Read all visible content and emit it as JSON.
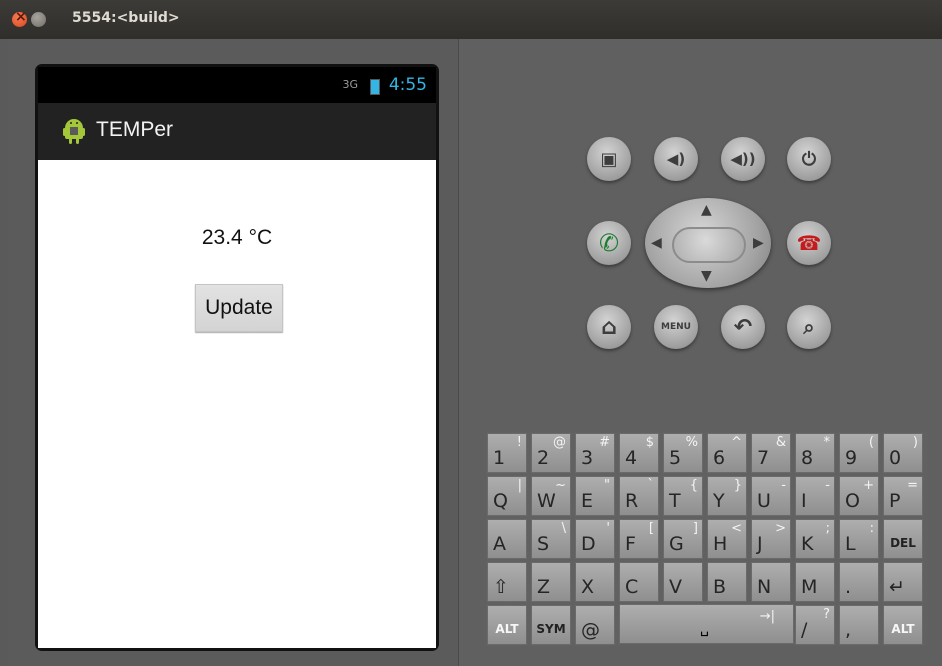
{
  "window": {
    "title": "5554:<build>"
  },
  "device": {
    "statusbar": {
      "signal": "3G",
      "time": "4:55"
    },
    "app": {
      "title": "TEMPer",
      "temperature": "23.4 °C",
      "update_label": "Update"
    }
  },
  "controls": {
    "menu_label": "MENU",
    "icons": [
      "camera-icon",
      "volume-down-icon",
      "volume-up-icon",
      "power-icon",
      "call-icon",
      "end-call-icon",
      "home-icon",
      "menu-icon",
      "back-icon",
      "search-icon"
    ]
  },
  "keyboard": {
    "rows": [
      [
        {
          "main": "1",
          "alt": "!"
        },
        {
          "main": "2",
          "alt": "@"
        },
        {
          "main": "3",
          "alt": "#"
        },
        {
          "main": "4",
          "alt": "$"
        },
        {
          "main": "5",
          "alt": "%"
        },
        {
          "main": "6",
          "alt": "^"
        },
        {
          "main": "7",
          "alt": "&"
        },
        {
          "main": "8",
          "alt": "*"
        },
        {
          "main": "9",
          "alt": "("
        },
        {
          "main": "0",
          "alt": ")"
        }
      ],
      [
        {
          "main": "Q",
          "alt": "|"
        },
        {
          "main": "W",
          "alt": "~"
        },
        {
          "main": "E",
          "alt": "\""
        },
        {
          "main": "R",
          "alt": "`"
        },
        {
          "main": "T",
          "alt": "{"
        },
        {
          "main": "Y",
          "alt": "}"
        },
        {
          "main": "U",
          "alt": "-"
        },
        {
          "main": "I",
          "alt": "-"
        },
        {
          "main": "O",
          "alt": "+"
        },
        {
          "main": "P",
          "alt": "="
        }
      ],
      [
        {
          "main": "A",
          "alt": ""
        },
        {
          "main": "S",
          "alt": "\\"
        },
        {
          "main": "D",
          "alt": "'"
        },
        {
          "main": "F",
          "alt": "["
        },
        {
          "main": "G",
          "alt": "]"
        },
        {
          "main": "H",
          "alt": "<"
        },
        {
          "main": "J",
          "alt": ">"
        },
        {
          "main": "K",
          "alt": ";"
        },
        {
          "main": "L",
          "alt": ":"
        },
        {
          "main": "DEL",
          "alt": ""
        }
      ],
      [
        {
          "main": "⇧",
          "alt": ""
        },
        {
          "main": "Z",
          "alt": ""
        },
        {
          "main": "X",
          "alt": ""
        },
        {
          "main": "C",
          "alt": ""
        },
        {
          "main": "V",
          "alt": ""
        },
        {
          "main": "B",
          "alt": ""
        },
        {
          "main": "N",
          "alt": ""
        },
        {
          "main": "M",
          "alt": ""
        },
        {
          "main": ".",
          "alt": ""
        },
        {
          "main": "↵",
          "alt": ""
        }
      ],
      [
        {
          "main": "ALT",
          "alt": ""
        },
        {
          "main": "SYM",
          "alt": ""
        },
        {
          "main": "@",
          "alt": ""
        },
        {
          "main": "␣",
          "alt": "→|"
        },
        {
          "main": "/",
          "alt": "?"
        },
        {
          "main": ",",
          "alt": ""
        },
        {
          "main": "ALT",
          "alt": ""
        }
      ]
    ]
  }
}
